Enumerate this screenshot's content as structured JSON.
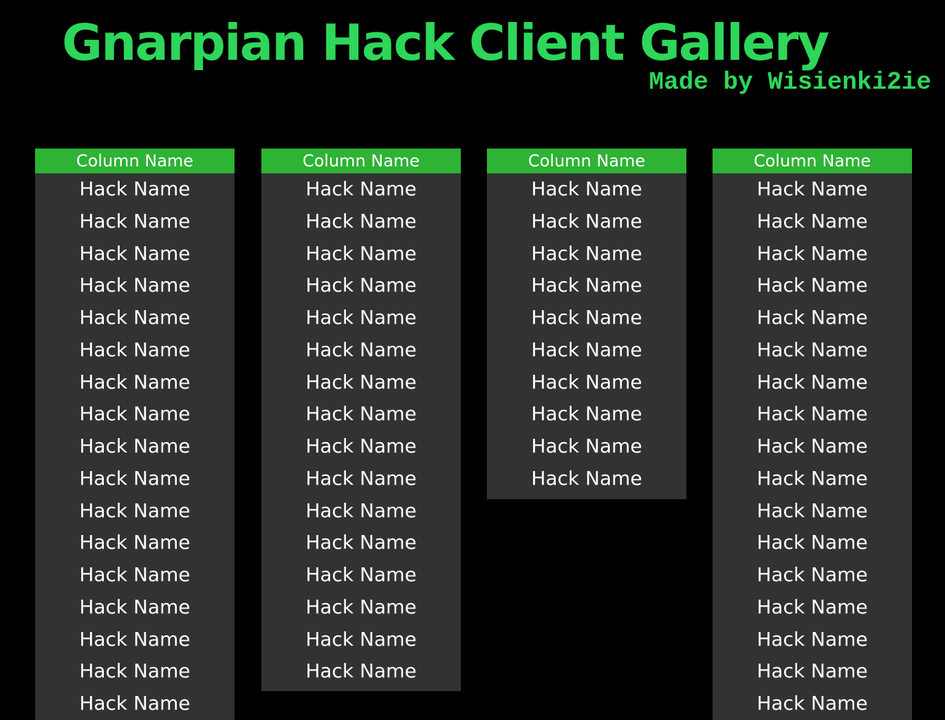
{
  "header": {
    "title": "Gnarpian Hack Client Gallery",
    "subtitle": "Made by Wisienki2ie"
  },
  "colors": {
    "background": "#000000",
    "title": "#2ed65a",
    "column_header": "#2eb335",
    "column_body": "#323232",
    "text": "#ffffff"
  },
  "columns": [
    {
      "header": "Column Name",
      "items": [
        "Hack Name",
        "Hack Name",
        "Hack Name",
        "Hack Name",
        "Hack Name",
        "Hack Name",
        "Hack Name",
        "Hack Name",
        "Hack Name",
        "Hack Name",
        "Hack Name",
        "Hack Name",
        "Hack Name",
        "Hack Name",
        "Hack Name",
        "Hack Name",
        "Hack Name"
      ]
    },
    {
      "header": "Column Name",
      "items": [
        "Hack Name",
        "Hack Name",
        "Hack Name",
        "Hack Name",
        "Hack Name",
        "Hack Name",
        "Hack Name",
        "Hack Name",
        "Hack Name",
        "Hack Name",
        "Hack Name",
        "Hack Name",
        "Hack Name",
        "Hack Name",
        "Hack Name",
        "Hack Name"
      ]
    },
    {
      "header": "Column Name",
      "items": [
        "Hack Name",
        "Hack Name",
        "Hack Name",
        "Hack Name",
        "Hack Name",
        "Hack Name",
        "Hack Name",
        "Hack Name",
        "Hack Name",
        "Hack Name"
      ]
    },
    {
      "header": "Column Name",
      "items": [
        "Hack Name",
        "Hack Name",
        "Hack Name",
        "Hack Name",
        "Hack Name",
        "Hack Name",
        "Hack Name",
        "Hack Name",
        "Hack Name",
        "Hack Name",
        "Hack Name",
        "Hack Name",
        "Hack Name",
        "Hack Name",
        "Hack Name",
        "Hack Name",
        "Hack Name"
      ]
    }
  ]
}
